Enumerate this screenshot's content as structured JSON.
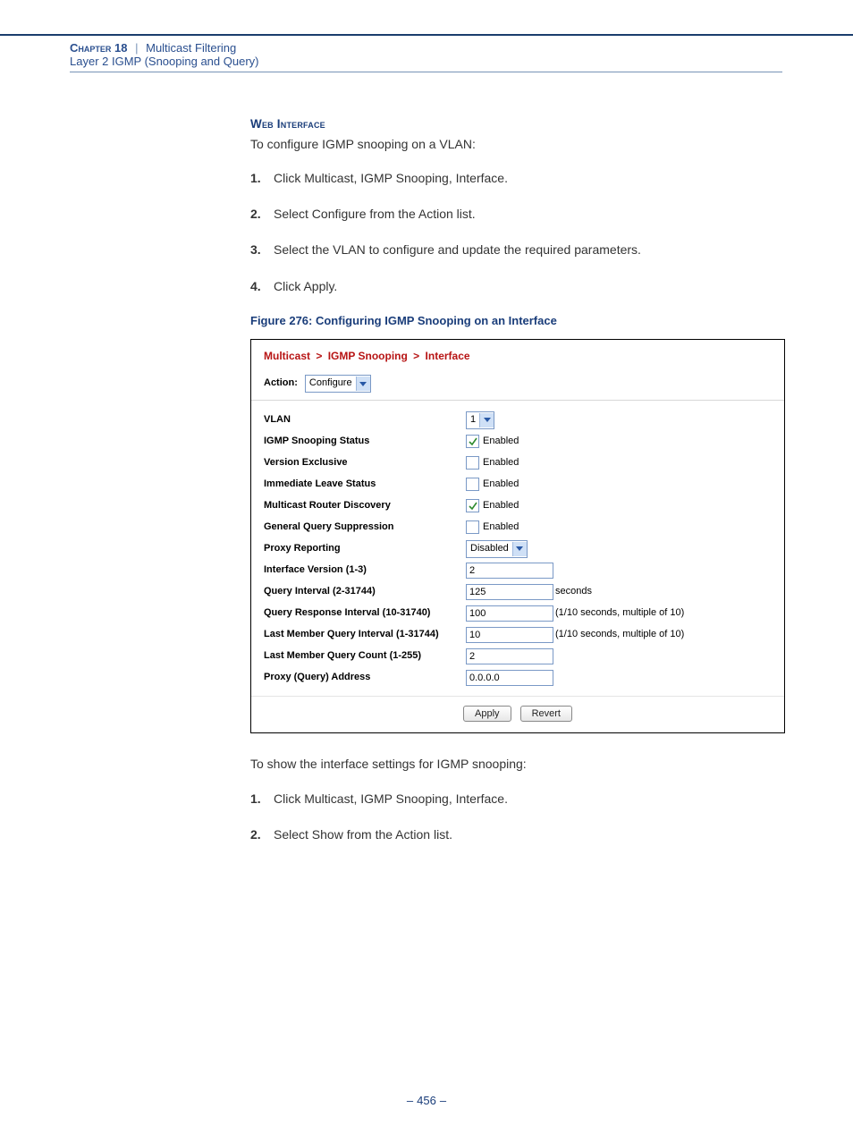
{
  "header": {
    "chapter_label": "Chapter 18",
    "chapter_title": "Multicast Filtering",
    "subtitle": "Layer 2 IGMP (Snooping and Query)"
  },
  "section1": {
    "heading": "Web Interface",
    "intro": "To configure IGMP snooping on a VLAN:",
    "steps": [
      "Click Multicast, IGMP Snooping, Interface.",
      "Select Configure from the Action list.",
      "Select the VLAN to configure and update the required parameters.",
      "Click Apply."
    ]
  },
  "figure": {
    "caption": "Figure 276:  Configuring IGMP Snooping on an Interface",
    "breadcrumb": [
      "Multicast",
      "IGMP Snooping",
      "Interface"
    ],
    "action_label": "Action:",
    "action_value": "Configure",
    "rows": [
      {
        "id": "vlan",
        "label": "VLAN",
        "type": "dropdown",
        "value": "1"
      },
      {
        "id": "snoop",
        "label": "IGMP Snooping Status",
        "type": "checkbox",
        "checked": true,
        "caption": "Enabled"
      },
      {
        "id": "verex",
        "label": "Version Exclusive",
        "type": "checkbox",
        "checked": false,
        "caption": "Enabled"
      },
      {
        "id": "ileave",
        "label": "Immediate Leave Status",
        "type": "checkbox",
        "checked": false,
        "caption": "Enabled"
      },
      {
        "id": "mrdisc",
        "label": "Multicast Router Discovery",
        "type": "checkbox",
        "checked": true,
        "caption": "Enabled"
      },
      {
        "id": "gqsupp",
        "label": "General Query Suppression",
        "type": "checkbox",
        "checked": false,
        "caption": "Enabled"
      },
      {
        "id": "proxyr",
        "label": "Proxy Reporting",
        "type": "dropdown",
        "value": "Disabled"
      },
      {
        "id": "ifver",
        "label": "Interface Version (1-3)",
        "type": "text",
        "value": "2"
      },
      {
        "id": "qint",
        "label": "Query Interval (2-31744)",
        "type": "text",
        "value": "125",
        "extra": "seconds"
      },
      {
        "id": "qresp",
        "label": "Query Response Interval (10-31740)",
        "type": "text",
        "value": "100",
        "extra": "(1/10 seconds, multiple of 10)"
      },
      {
        "id": "lmqi",
        "label": "Last Member Query Interval (1-31744)",
        "type": "text",
        "value": "10",
        "extra": "(1/10 seconds, multiple of 10)"
      },
      {
        "id": "lmqc",
        "label": "Last Member Query Count (1-255)",
        "type": "text",
        "value": "2"
      },
      {
        "id": "proxyq",
        "label": "Proxy (Query) Address",
        "type": "text",
        "value": "0.0.0.0"
      }
    ],
    "buttons": {
      "apply": "Apply",
      "revert": "Revert"
    }
  },
  "section2": {
    "intro": "To show the interface settings for IGMP snooping:",
    "steps": [
      "Click Multicast, IGMP Snooping, Interface.",
      "Select Show from the Action list."
    ]
  },
  "page_number": "456"
}
